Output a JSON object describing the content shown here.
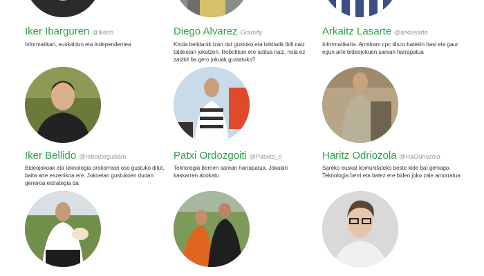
{
  "members": [
    {
      "name": "Iker Ibarguren",
      "handle": "@ikerib",
      "bio": [
        "Informatikari, euskaldun eta independentea"
      ]
    },
    {
      "name": "Diego Alvarez",
      "handle": "Gramify",
      "bio": [
        "Kirola betidanik izan dut gustoko eta txikitatik ibili naiz",
        "taldeetan jokatzen. Robotikan ere aditua naiz, nola ez",
        "zaizkit ba gero jokuak gustatuko?"
      ]
    },
    {
      "name": "Arkaitz Lasarte",
      "handle": "@arklasarte",
      "bio": [
        "Informatikaria. Amstram cpc disco batekin hasi eta gaur",
        "egun arte bideojokuen sarean harrapatua"
      ]
    },
    {
      "name": "Iker Bellido",
      "handle": "@robouteguiliam",
      "bio": [
        "Bideojokoak eta teknologia orokorrean oso gustuko ditut,",
        "baita arte eszenikoa ere. Jokoetan gustukoen dudan",
        "generoa estrategia da"
      ]
    },
    {
      "name": "Patxi Ordozgoiti",
      "handle": "@Patxito_o",
      "bio": [
        "Teknologia berrien sarean harrapatua. Jokalari",
        "kaskarren abokatu"
      ]
    },
    {
      "name": "Haritz Odriozola",
      "handle": "@HaOdriozola",
      "bio": [
        "Sareko euskal komunitateko beste kide bat gehiago.",
        "Teknologia berri eta batez ere bideo joko zale amorratua"
      ]
    }
  ],
  "colors": {
    "name_green": "#2aa147",
    "handle_gray": "#9a9a9a",
    "bio_text": "#333333"
  }
}
